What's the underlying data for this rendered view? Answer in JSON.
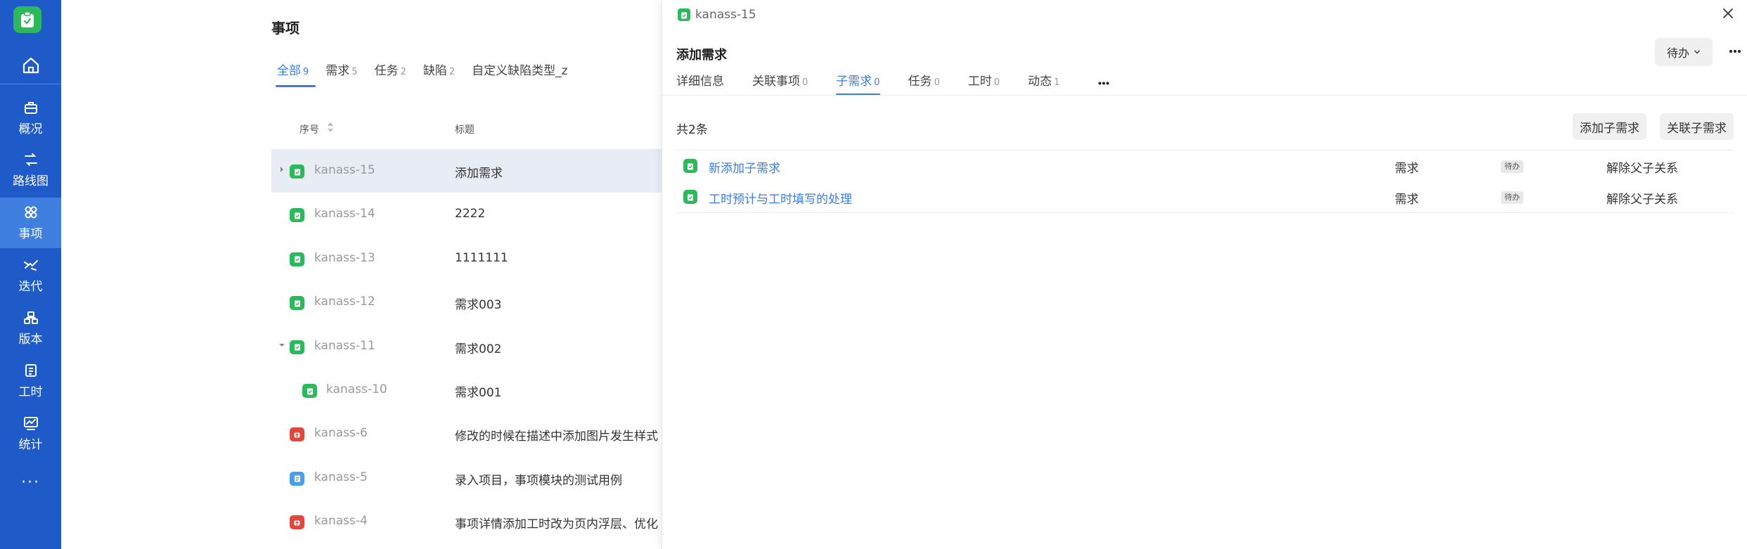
{
  "sidebar": {
    "items": [
      {
        "label": "概况",
        "icon": "briefcase-icon"
      },
      {
        "label": "路线图",
        "icon": "route-icon"
      },
      {
        "label": "事项",
        "icon": "issue-icon",
        "active": true
      },
      {
        "label": "迭代",
        "icon": "sprint-icon"
      },
      {
        "label": "版本",
        "icon": "version-icon"
      },
      {
        "label": "工时",
        "icon": "timesheet-icon"
      },
      {
        "label": "统计",
        "icon": "statistics-icon"
      }
    ],
    "more": "···"
  },
  "issues": {
    "title": "事项",
    "tabs": [
      {
        "label": "全部",
        "count": "9",
        "active": true
      },
      {
        "label": "需求",
        "count": "5"
      },
      {
        "label": "任务",
        "count": "2"
      },
      {
        "label": "缺陷",
        "count": "2"
      },
      {
        "label": "自定义缺陷类型_z",
        "count": ""
      }
    ],
    "columns": {
      "no": "序号",
      "title": "标题"
    },
    "rows": [
      {
        "code": "kanass-15",
        "title": "添加需求",
        "type": "demand",
        "selected": true,
        "chevron": "right",
        "indent": 0
      },
      {
        "code": "kanass-14",
        "title": "2222",
        "type": "demand",
        "indent": 0
      },
      {
        "code": "kanass-13",
        "title": "1111111",
        "type": "demand",
        "indent": 0
      },
      {
        "code": "kanass-12",
        "title": "需求003",
        "type": "demand",
        "indent": 0
      },
      {
        "code": "kanass-11",
        "title": "需求002",
        "type": "demand",
        "chevron": "down",
        "indent": 0
      },
      {
        "code": "kanass-10",
        "title": "需求001",
        "type": "demand",
        "indent": 1
      },
      {
        "code": "kanass-6",
        "title": "修改的时候在描述中添加图片发生样式",
        "type": "bug",
        "indent": 0
      },
      {
        "code": "kanass-5",
        "title": "录入项目，事项模块的测试用例",
        "type": "task",
        "indent": 0
      },
      {
        "code": "kanass-4",
        "title": "事项详情添加工时改为页内浮层、优化",
        "type": "bug",
        "indent": 0
      }
    ]
  },
  "detail": {
    "code": "kanass-15",
    "title": "添加需求",
    "status": "待办",
    "tabs": [
      {
        "label": "详细信息",
        "count": ""
      },
      {
        "label": "关联事项",
        "count": "0"
      },
      {
        "label": "子需求",
        "count": "0",
        "active": true
      },
      {
        "label": "任务",
        "count": "0"
      },
      {
        "label": "工时",
        "count": "0"
      },
      {
        "label": "动态",
        "count": "1"
      }
    ],
    "total": "共2条",
    "add_button": "添加子需求",
    "link_button": "关联子需求",
    "children": [
      {
        "name": "新添加子需求",
        "type": "需求",
        "status": "待办",
        "action": "解除父子关系"
      },
      {
        "name": "工时预计与工时填写的处理",
        "type": "需求",
        "status": "待办",
        "action": "解除父子关系"
      }
    ]
  },
  "colors": {
    "sidebar": "#1e5ac8",
    "sidebar_active": "#3f7fe0",
    "accent": "#3a7de0",
    "demand": "#2eb85c",
    "bug": "#e0483e",
    "task": "#4aa0e6"
  }
}
